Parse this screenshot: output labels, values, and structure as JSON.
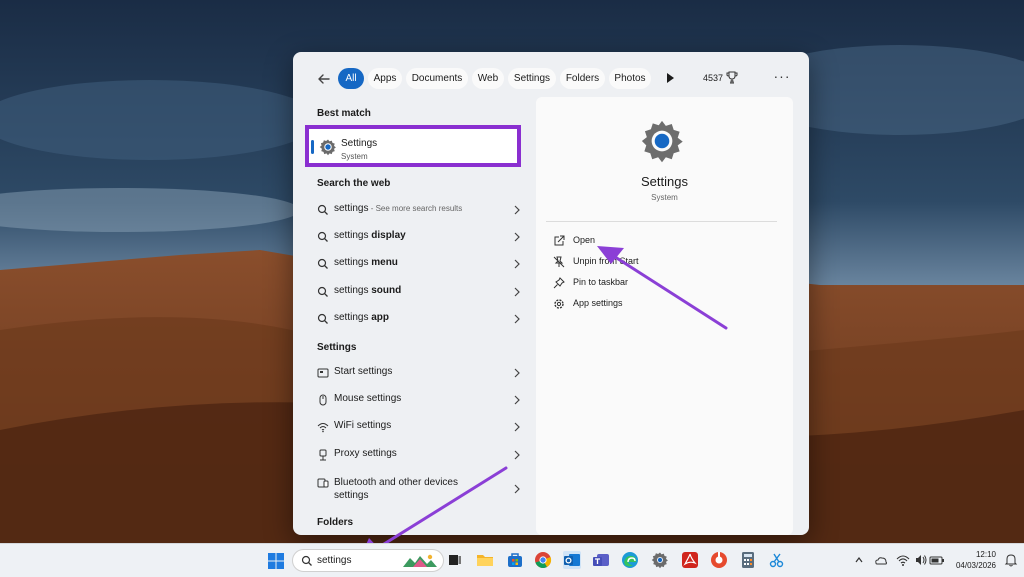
{
  "filters": {
    "back_icon": "back-arrow-icon",
    "items": [
      "All",
      "Apps",
      "Documents",
      "Web",
      "Settings",
      "Folders",
      "Photos"
    ],
    "active": "All",
    "points": "4537",
    "more_icon": "more-icon"
  },
  "best_match": {
    "heading": "Best match",
    "title": "Settings",
    "subtitle": "System",
    "icon": "gear-icon"
  },
  "web": {
    "heading": "Search the web",
    "items": [
      {
        "prefix": "settings",
        "bold": "",
        "hint": " - See more search results"
      },
      {
        "prefix": "settings ",
        "bold": "display",
        "hint": ""
      },
      {
        "prefix": "settings ",
        "bold": "menu",
        "hint": ""
      },
      {
        "prefix": "settings ",
        "bold": "sound",
        "hint": ""
      },
      {
        "prefix": "settings ",
        "bold": "app",
        "hint": ""
      }
    ]
  },
  "settings_section": {
    "heading": "Settings",
    "items": [
      {
        "label": "Start settings",
        "icon": "start-menu-icon"
      },
      {
        "label": "Mouse settings",
        "icon": "mouse-icon"
      },
      {
        "label": "WiFi settings",
        "icon": "wifi-icon"
      },
      {
        "label": "Proxy settings",
        "icon": "proxy-icon"
      },
      {
        "label": "Bluetooth and other devices settings",
        "icon": "bluetooth-devices-icon"
      }
    ]
  },
  "folders_heading": "Folders",
  "preview": {
    "title": "Settings",
    "subtitle": "System",
    "actions": [
      {
        "label": "Open",
        "icon": "open-external-icon"
      },
      {
        "label": "Unpin from Start",
        "icon": "unpin-icon"
      },
      {
        "label": "Pin to taskbar",
        "icon": "pin-icon"
      },
      {
        "label": "App settings",
        "icon": "gear-icon"
      }
    ]
  },
  "taskbar": {
    "search_value": "settings",
    "apps": [
      "task-view-icon",
      "file-explorer-icon",
      "store-icon",
      "chrome-icon",
      "outlook-icon",
      "teams-icon",
      "edge-icon",
      "settings-icon",
      "acrobat-icon",
      "office-icon",
      "calculator-icon",
      "snipping-tool-icon"
    ],
    "time": "12:10",
    "date": "04/03/2026"
  },
  "colors": {
    "accent": "#1668c4",
    "highlight": "#8a2fd0",
    "arrow": "#8b3fd6"
  }
}
